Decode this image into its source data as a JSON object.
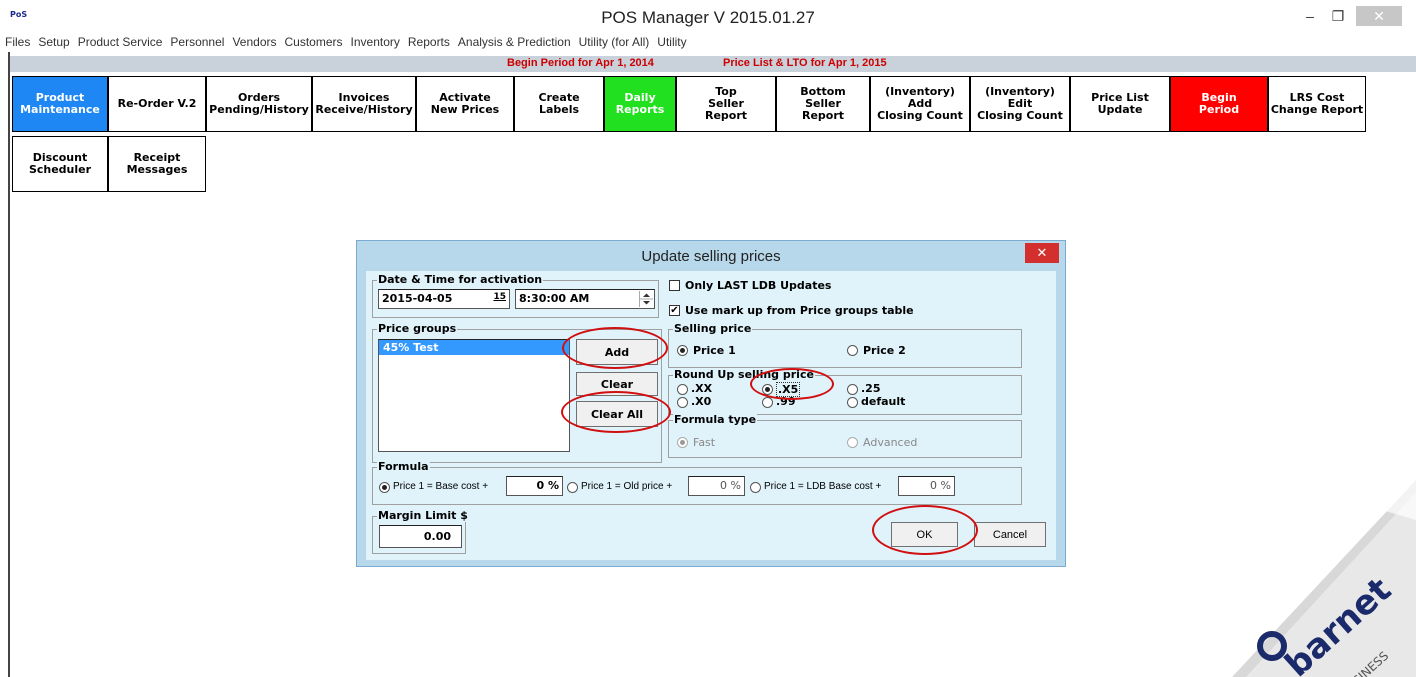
{
  "window": {
    "logo": "PoS",
    "title": "POS Manager V 2015.01.27",
    "min_glyph": "–",
    "max_glyph": "❐",
    "close_glyph": "✕"
  },
  "menu": [
    "Files",
    "Setup",
    "Product Service",
    "Personnel",
    "Vendors",
    "Customers",
    "Inventory",
    "Reports",
    "Analysis & Prediction",
    "Utility (for All)",
    "Utility"
  ],
  "infobar": {
    "period": "Begin Period for  Apr 1, 2014",
    "price_list": "Price List & LTO for  Apr 1, 2015",
    "color": "#cc0000"
  },
  "toolbar": {
    "row1": [
      {
        "label": "Product\nMaintenance",
        "color": "#1f87f3"
      },
      {
        "label": "Re-Order V.2"
      },
      {
        "label": "Orders\nPending/History"
      },
      {
        "label": "Invoices\nReceive/History"
      },
      {
        "label": "Activate\nNew Prices"
      },
      {
        "label": "Create\nLabels"
      },
      {
        "label": "Daily\nReports",
        "color": "#20e020"
      },
      {
        "label": "Top\nSeller\nReport"
      },
      {
        "label": "Bottom\nSeller\nReport"
      },
      {
        "label": "(Inventory)\nAdd\nClosing Count"
      },
      {
        "label": "(Inventory)\nEdit\nClosing Count"
      },
      {
        "label": "Price List\nUpdate"
      },
      {
        "label": "Begin\nPeriod",
        "color": "#ff0000"
      },
      {
        "label": "LRS Cost\nChange Report"
      }
    ],
    "row2": [
      {
        "label": "Discount\nScheduler"
      },
      {
        "label": "Receipt\nMessages"
      }
    ]
  },
  "dialog": {
    "title": "Update selling prices",
    "close_glyph": "✕",
    "activation": {
      "group_title": "Date & Time for activation",
      "date": "2015-04-05",
      "calendar_glyph": "15",
      "time": "8:30:00 AM"
    },
    "only_last_ldb": {
      "label": "Only LAST LDB Updates",
      "checked": false
    },
    "use_markup": {
      "label": "Use mark up from Price groups table",
      "checked": true,
      "mark": "✔"
    },
    "price_groups": {
      "group_title": "Price groups",
      "items": [
        "45% Test"
      ],
      "add_label": "Add",
      "clear_label": "Clear",
      "clear_all_label": "Clear All"
    },
    "selling_price": {
      "group_title": "Selling price",
      "options": [
        "Price 1",
        "Price 2"
      ],
      "selected": "Price 1"
    },
    "round_up": {
      "group_title": "Round Up selling price",
      "options": [
        ".XX",
        ".X5",
        ".25",
        ".X0",
        ".99",
        "default"
      ],
      "selected": ".X5"
    },
    "formula_type": {
      "group_title": "Formula type",
      "options": [
        "Fast",
        "Advanced"
      ],
      "selected": "Fast"
    },
    "formula": {
      "group_title": "Formula",
      "opt1_label": "Price 1 = Base cost +",
      "opt1_value": "0 %",
      "opt2_label": "Price 1 = Old price +",
      "opt2_value": "0 %",
      "opt3_label": "Price 1 = LDB Base cost +",
      "opt3_value": "0 %",
      "selected": "Price 1 = Base cost +"
    },
    "margin_limit": {
      "group_title": "Margin Limit $",
      "value": "0.00"
    },
    "ok_label": "OK",
    "cancel_label": "Cancel"
  },
  "watermark": {
    "brand": "barnet",
    "tag": "BUSINESS"
  },
  "annotation_color": "#d01010"
}
